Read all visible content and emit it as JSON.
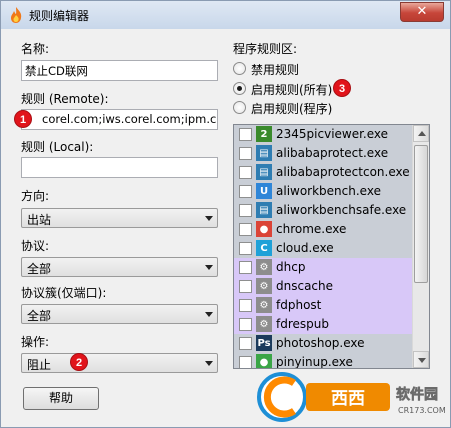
{
  "window": {
    "title": "规则编辑器",
    "close_label": "✕"
  },
  "form": {
    "name_label": "名称:",
    "name_value": "禁止CD联网",
    "remote_label": "规则 (Remote):",
    "remote_value": "corel.com;iws.corel.com;ipm.corel.com",
    "local_label": "规则 (Local):",
    "local_value": "",
    "direction_label": "方向:",
    "direction_value": "出站",
    "protocol_label": "协议:",
    "protocol_value": "全部",
    "family_label": "协议簇(仅端口):",
    "family_value": "全部",
    "action_label": "操作:",
    "action_value": "阻止",
    "help_label": "帮助"
  },
  "program_area": {
    "label": "程序规则区:",
    "options": [
      "禁用规则",
      "启用规则(所有)",
      "启用规则(程序)"
    ],
    "selected_index": 1
  },
  "programs": [
    {
      "name": "2345picviewer.exe",
      "icon": "picviewer-icon",
      "glyph": "2",
      "icon_color": "#3a8a2c",
      "row_color": "#c9ced6"
    },
    {
      "name": "alibabaprotect.exe",
      "icon": "app-window-icon",
      "glyph": "▤",
      "icon_color": "#2f7db2",
      "row_color": "#c9ced6"
    },
    {
      "name": "alibabaprotectcon.exe",
      "icon": "app-window-icon",
      "glyph": "▤",
      "icon_color": "#2f7db2",
      "row_color": "#c9ced6"
    },
    {
      "name": "aliworkbench.exe",
      "icon": "aliworkbench-icon",
      "glyph": "U",
      "icon_color": "#2f86d8",
      "row_color": "#c9ced6"
    },
    {
      "name": "aliworkbenchsafe.exe",
      "icon": "app-window-icon",
      "glyph": "▤",
      "icon_color": "#2f7db2",
      "row_color": "#c9ced6"
    },
    {
      "name": "chrome.exe",
      "icon": "chrome-icon",
      "glyph": "●",
      "icon_color": "#db4437",
      "row_color": "#c9ced6"
    },
    {
      "name": "cloud.exe",
      "icon": "cloud-icon",
      "glyph": "C",
      "icon_color": "#1fa1d8",
      "row_color": "#c9ced6"
    },
    {
      "name": "dhcp",
      "icon": "service-gear-icon",
      "glyph": "⚙",
      "icon_color": "#8d8d8d",
      "row_color": "#d8c8f8"
    },
    {
      "name": "dnscache",
      "icon": "service-gear-icon",
      "glyph": "⚙",
      "icon_color": "#8d8d8d",
      "row_color": "#d8c8f8"
    },
    {
      "name": "fdphost",
      "icon": "service-gear-icon",
      "glyph": "⚙",
      "icon_color": "#8d8d8d",
      "row_color": "#d8c8f8"
    },
    {
      "name": "fdrespub",
      "icon": "service-gear-icon",
      "glyph": "⚙",
      "icon_color": "#8d8d8d",
      "row_color": "#d8c8f8"
    },
    {
      "name": "photoshop.exe",
      "icon": "photoshop-icon",
      "glyph": "Ps",
      "icon_color": "#1c3b5c",
      "row_color": "#c9ced6"
    },
    {
      "name": "pinyinup.exe",
      "icon": "pinyin-icon",
      "glyph": "●",
      "icon_color": "#3aa546",
      "row_color": "#c9ced6"
    }
  ],
  "badges": {
    "one": "1",
    "two": "2",
    "three": "3"
  },
  "watermark": {
    "text": "西西软件园",
    "sub": "CR173.COM"
  }
}
